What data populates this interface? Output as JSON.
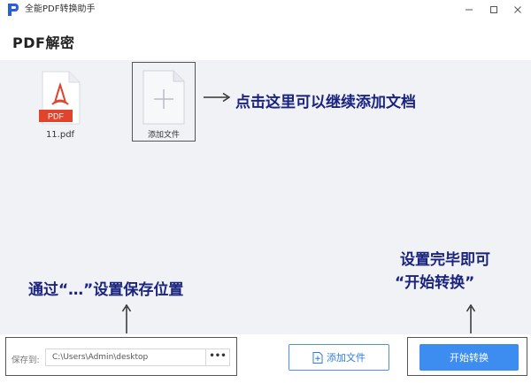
{
  "window": {
    "app_title": "全能PDF转换助手",
    "controls": [
      "minimize",
      "maximize",
      "close"
    ]
  },
  "page": {
    "title": "PDF解密"
  },
  "files": [
    {
      "name": "11.pdf",
      "type_badge": "PDF"
    }
  ],
  "add_tile": {
    "label": "添加文件"
  },
  "annotations": {
    "add_hint": "点击这里可以继续添加文档",
    "save_hint": "通过“…”设置保存位置",
    "start_hint_line1": "设置完毕即可",
    "start_hint_line2": "“开始转换”"
  },
  "save": {
    "label": "保存到:",
    "path": "C:\\Users\\Admin\\desktop",
    "browse_label": "•••"
  },
  "buttons": {
    "add_file": "添加文件",
    "start": "开始转换"
  },
  "colors": {
    "accent": "#3d8cf0",
    "annotation": "#1a237e",
    "pdf_badge": "#e0442c",
    "work_area_bg": "#f0f2f5"
  }
}
